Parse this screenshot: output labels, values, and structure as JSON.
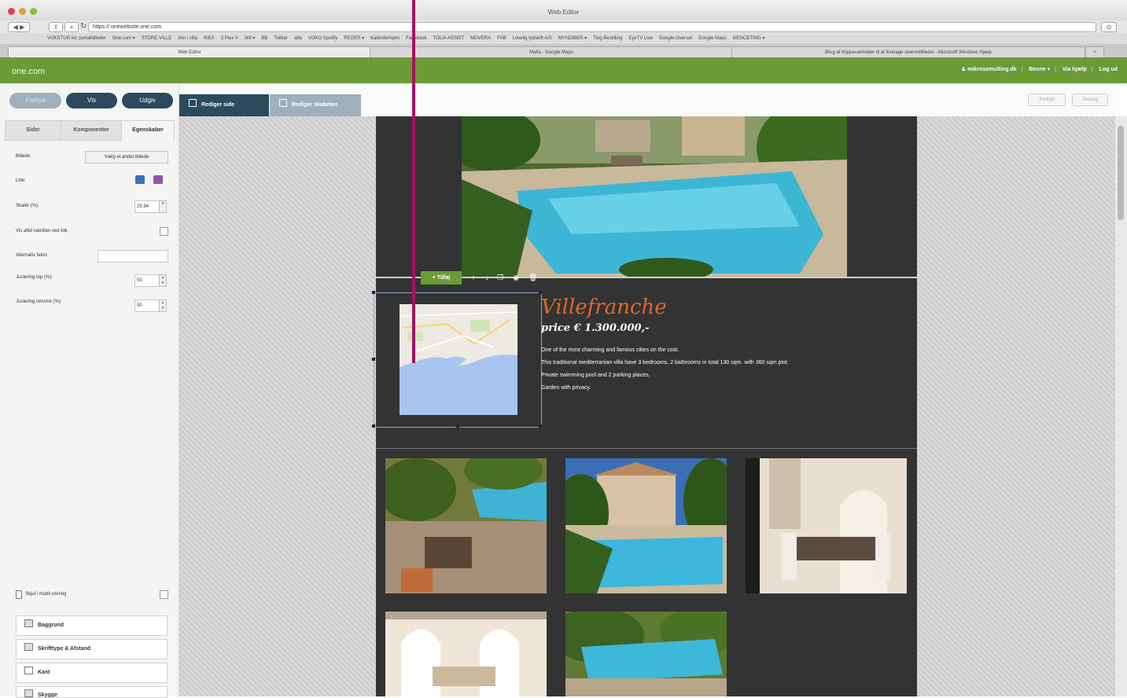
{
  "browser": {
    "window_title": "Web Editor",
    "url": "https:// onewebsite.one.com",
    "bookmarks": [
      "VOKSTUG kit: portalbilleder",
      "One.com ▾",
      "STORE VILLE",
      "min i villa",
      "IKEA",
      "3 Plex V",
      "Wif ▾",
      "BB",
      "Twitter",
      "alfa",
      "VOKO Spotify",
      "REGER ▾",
      "Kalenderhjem",
      "Facebook",
      "TOLIA ASSIST",
      "MOVERA",
      "FAB",
      "Lovelig fydskift A/S",
      "MYNDIBER ▾",
      "Ting Bestilling",
      "EyeTV Live",
      "Google Oversat",
      "Google Maps",
      "MENCETING ▾"
    ],
    "tabs": [
      "Web Editor",
      "Malta - Google Maps",
      "Brug af Klippeværktøjer til at foretage skærmbilleder - Microsoft Windows Hjælp"
    ]
  },
  "header": {
    "logo": "one.com",
    "user": "mikrosemulting.dk",
    "links": [
      "Benne ▾",
      "Via hjælp",
      "Log ud"
    ]
  },
  "sidebar": {
    "buttons": {
      "undo": "Fortryd",
      "view": "Vis",
      "publish": "Udgiv"
    },
    "tabs": [
      "Sider",
      "Komponenter",
      "Egenskaber"
    ],
    "props": {
      "image_label": "Billede:",
      "image_button": "Vælg et andet billede",
      "link_label": "Link:",
      "scale_label": "Skalér (%):",
      "scale_value": "25.94",
      "crop_label": "Vis altid værdien ved klik",
      "alt_label": "Alternativ tekst:",
      "align_top_label": "Justering top (%):",
      "align_top_value": "50",
      "align_left_label": "Justering venstre (%):",
      "align_left_value": "50"
    },
    "mobile_label": "Skjul i mobil visning",
    "sections": [
      "Baggrund",
      "Skrifttype & Afstand",
      "Kant",
      "Skygge"
    ]
  },
  "canvas_tabs": {
    "edit_page": "Rediger side",
    "edit_template": "Rediger skabelon",
    "undo": "Fortryd",
    "redo": "Gentag"
  },
  "component_toolbar": {
    "add": "Tilføj"
  },
  "listing": {
    "title": "Villefranche",
    "price": "price € 1.300.000,-",
    "description": [
      "One of the most charming and famous cities on the cost.",
      "This traditional mediterranian villa have 3 bedrooms, 2 bathrooms in total 130 sqm.  with 360 sqm plot.",
      "Private swimming pool and 2 parking places.",
      "Garden with privacy."
    ]
  },
  "colors": {
    "brand_green": "#6a9b37",
    "nav_blue": "#2b4a5e",
    "annotation": "#a61060",
    "title_orange": "#e0682c",
    "page_bg": "#333333"
  }
}
